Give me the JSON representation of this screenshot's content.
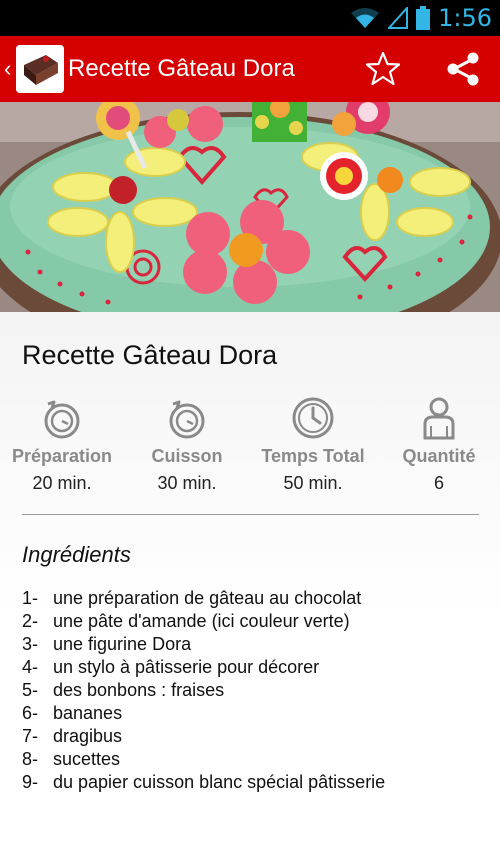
{
  "status_bar": {
    "time": "1:56"
  },
  "action_bar": {
    "title": "Recette Gâteau Dora"
  },
  "recipe": {
    "title": "Recette Gâteau Dora",
    "stats": [
      {
        "label": "Préparation",
        "value": "20 min.",
        "icon": "stopwatch-icon"
      },
      {
        "label": "Cuisson",
        "value": "30 min.",
        "icon": "stopwatch-icon"
      },
      {
        "label": "Temps Total",
        "value": "50 min.",
        "icon": "clock-icon"
      },
      {
        "label": "Quantité",
        "value": "6",
        "icon": "person-icon"
      }
    ],
    "ingredients_heading": "Ingrédients",
    "ingredients": [
      {
        "num": "1-",
        "text": "une préparation de gâteau au chocolat"
      },
      {
        "num": "2-",
        "text": "une pâte d'amande (ici couleur verte)"
      },
      {
        "num": "3-",
        "text": "une figurine Dora"
      },
      {
        "num": "4-",
        "text": "un stylo à pâtisserie pour décorer"
      },
      {
        "num": "5-",
        "text": "des bonbons : fraises"
      },
      {
        "num": "6-",
        "text": "bananes"
      },
      {
        "num": "7-",
        "text": "dragibus"
      },
      {
        "num": "8-",
        "text": "sucettes"
      },
      {
        "num": "9-",
        "text": "du papier cuisson blanc spécial pâtisserie"
      }
    ]
  },
  "colors": {
    "action_bar": "#d50000",
    "status_accent": "#33b5e5",
    "stat_label": "#8a8a8a"
  }
}
